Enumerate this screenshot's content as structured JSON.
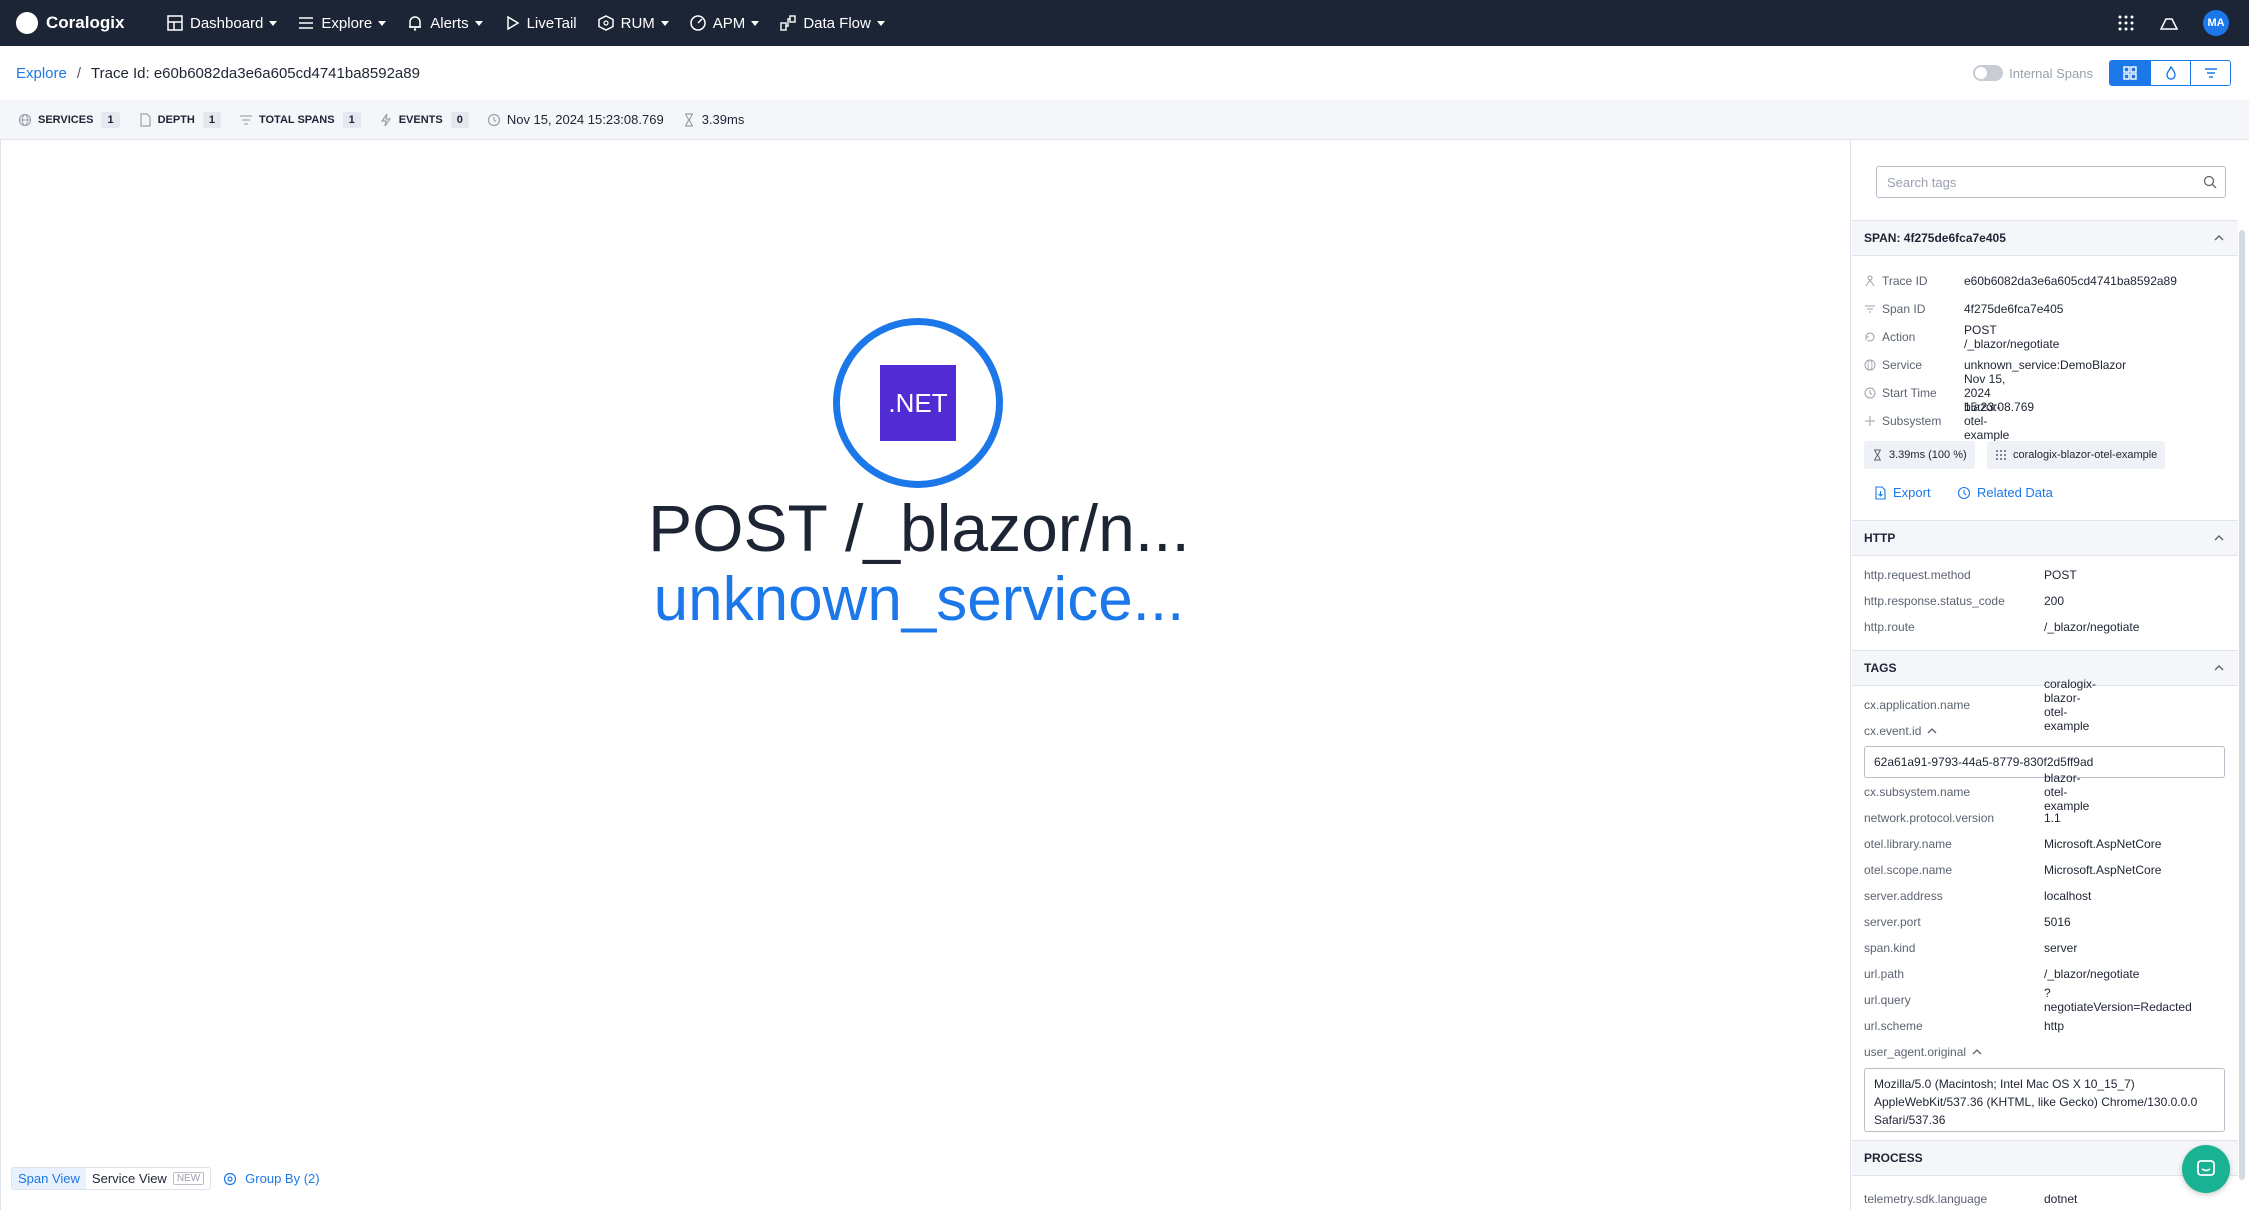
{
  "nav": {
    "brand": "Coralogix",
    "items": [
      {
        "label": "Dashboard",
        "icon": "dashboard-icon",
        "dropdown": true
      },
      {
        "label": "Explore",
        "icon": "explore-icon",
        "dropdown": true
      },
      {
        "label": "Alerts",
        "icon": "bell-icon",
        "dropdown": true
      },
      {
        "label": "LiveTail",
        "icon": "play-icon",
        "dropdown": false
      },
      {
        "label": "RUM",
        "icon": "cube-icon",
        "dropdown": true
      },
      {
        "label": "APM",
        "icon": "gauge-icon",
        "dropdown": true
      },
      {
        "label": "Data Flow",
        "icon": "dataflow-icon",
        "dropdown": true
      }
    ],
    "avatar": "MA"
  },
  "breadcrumb": {
    "link": "Explore",
    "separator": "/",
    "current": "Trace Id: e60b6082da3e6a605cd4741ba8592a89",
    "internal_spans_label": "Internal Spans"
  },
  "stats": {
    "services_label": "SERVICES",
    "services": "1",
    "depth_label": "DEPTH",
    "depth": "1",
    "total_spans_label": "TOTAL SPANS",
    "total_spans": "1",
    "events_label": "EVENTS",
    "events": "0",
    "timestamp": "Nov 15, 2024 15:23:08.769",
    "duration": "3.39ms"
  },
  "canvas": {
    "node_badge": ".NET",
    "node_title": "POST /_blazor/n...",
    "node_subtitle": "unknown_service...",
    "tabs": {
      "span_view": "Span View",
      "service_view": "Service View",
      "new_badge": "NEW"
    },
    "group_by": "Group By (2)"
  },
  "panel": {
    "search_placeholder": "Search tags",
    "span_section": "SPAN: 4f275de6fca7e405",
    "span_fields": [
      {
        "key": "Trace ID",
        "value": "e60b6082da3e6a605cd4741ba8592a89",
        "icon": "trace-icon"
      },
      {
        "key": "Span ID",
        "value": "4f275de6fca7e405",
        "icon": "span-icon"
      },
      {
        "key": "Action",
        "value": "POST /_blazor/negotiate",
        "icon": "action-icon"
      },
      {
        "key": "Service",
        "value": "unknown_service:DemoBlazor",
        "icon": "globe-icon"
      },
      {
        "key": "Start Time",
        "value": "Nov 15, 2024 15:23:08.769",
        "icon": "clock-icon"
      },
      {
        "key": "Subsystem",
        "value": "blazor-otel-example",
        "icon": "subsystem-icon"
      }
    ],
    "duration_chip": "3.39ms (100 %)",
    "app_chip": "coralogix-blazor-otel-example",
    "export_label": "Export",
    "related_label": "Related Data",
    "http_section": "HTTP",
    "http_fields": [
      {
        "key": "http.request.method",
        "value": "POST"
      },
      {
        "key": "http.response.status_code",
        "value": "200"
      },
      {
        "key": "http.route",
        "value": "/_blazor/negotiate"
      }
    ],
    "tags_section": "TAGS",
    "tag_app_key": "cx.application.name",
    "tag_app_value": "coralogix-blazor-otel-example",
    "tag_event_key": "cx.event.id",
    "tag_event_value": "62a61a91-9793-44a5-8779-830f2d5ff9ad",
    "tags": [
      {
        "key": "cx.subsystem.name",
        "value": "blazor-otel-example"
      },
      {
        "key": "network.protocol.version",
        "value": "1.1"
      },
      {
        "key": "otel.library.name",
        "value": "Microsoft.AspNetCore"
      },
      {
        "key": "otel.scope.name",
        "value": "Microsoft.AspNetCore"
      },
      {
        "key": "server.address",
        "value": "localhost"
      },
      {
        "key": "server.port",
        "value": "5016"
      },
      {
        "key": "span.kind",
        "value": "server"
      },
      {
        "key": "url.path",
        "value": "/_blazor/negotiate"
      },
      {
        "key": "url.query",
        "value": "?negotiateVersion=Redacted"
      },
      {
        "key": "url.scheme",
        "value": "http"
      }
    ],
    "ua_key": "user_agent.original",
    "ua_value": "Mozilla/5.0 (Macintosh; Intel Mac OS X 10_15_7) AppleWebKit/537.36 (KHTML, like Gecko) Chrome/130.0.0.0 Safari/537.36",
    "process_section": "PROCESS",
    "process_fields": [
      {
        "key": "telemetry.sdk.language",
        "value": "dotnet"
      }
    ]
  }
}
